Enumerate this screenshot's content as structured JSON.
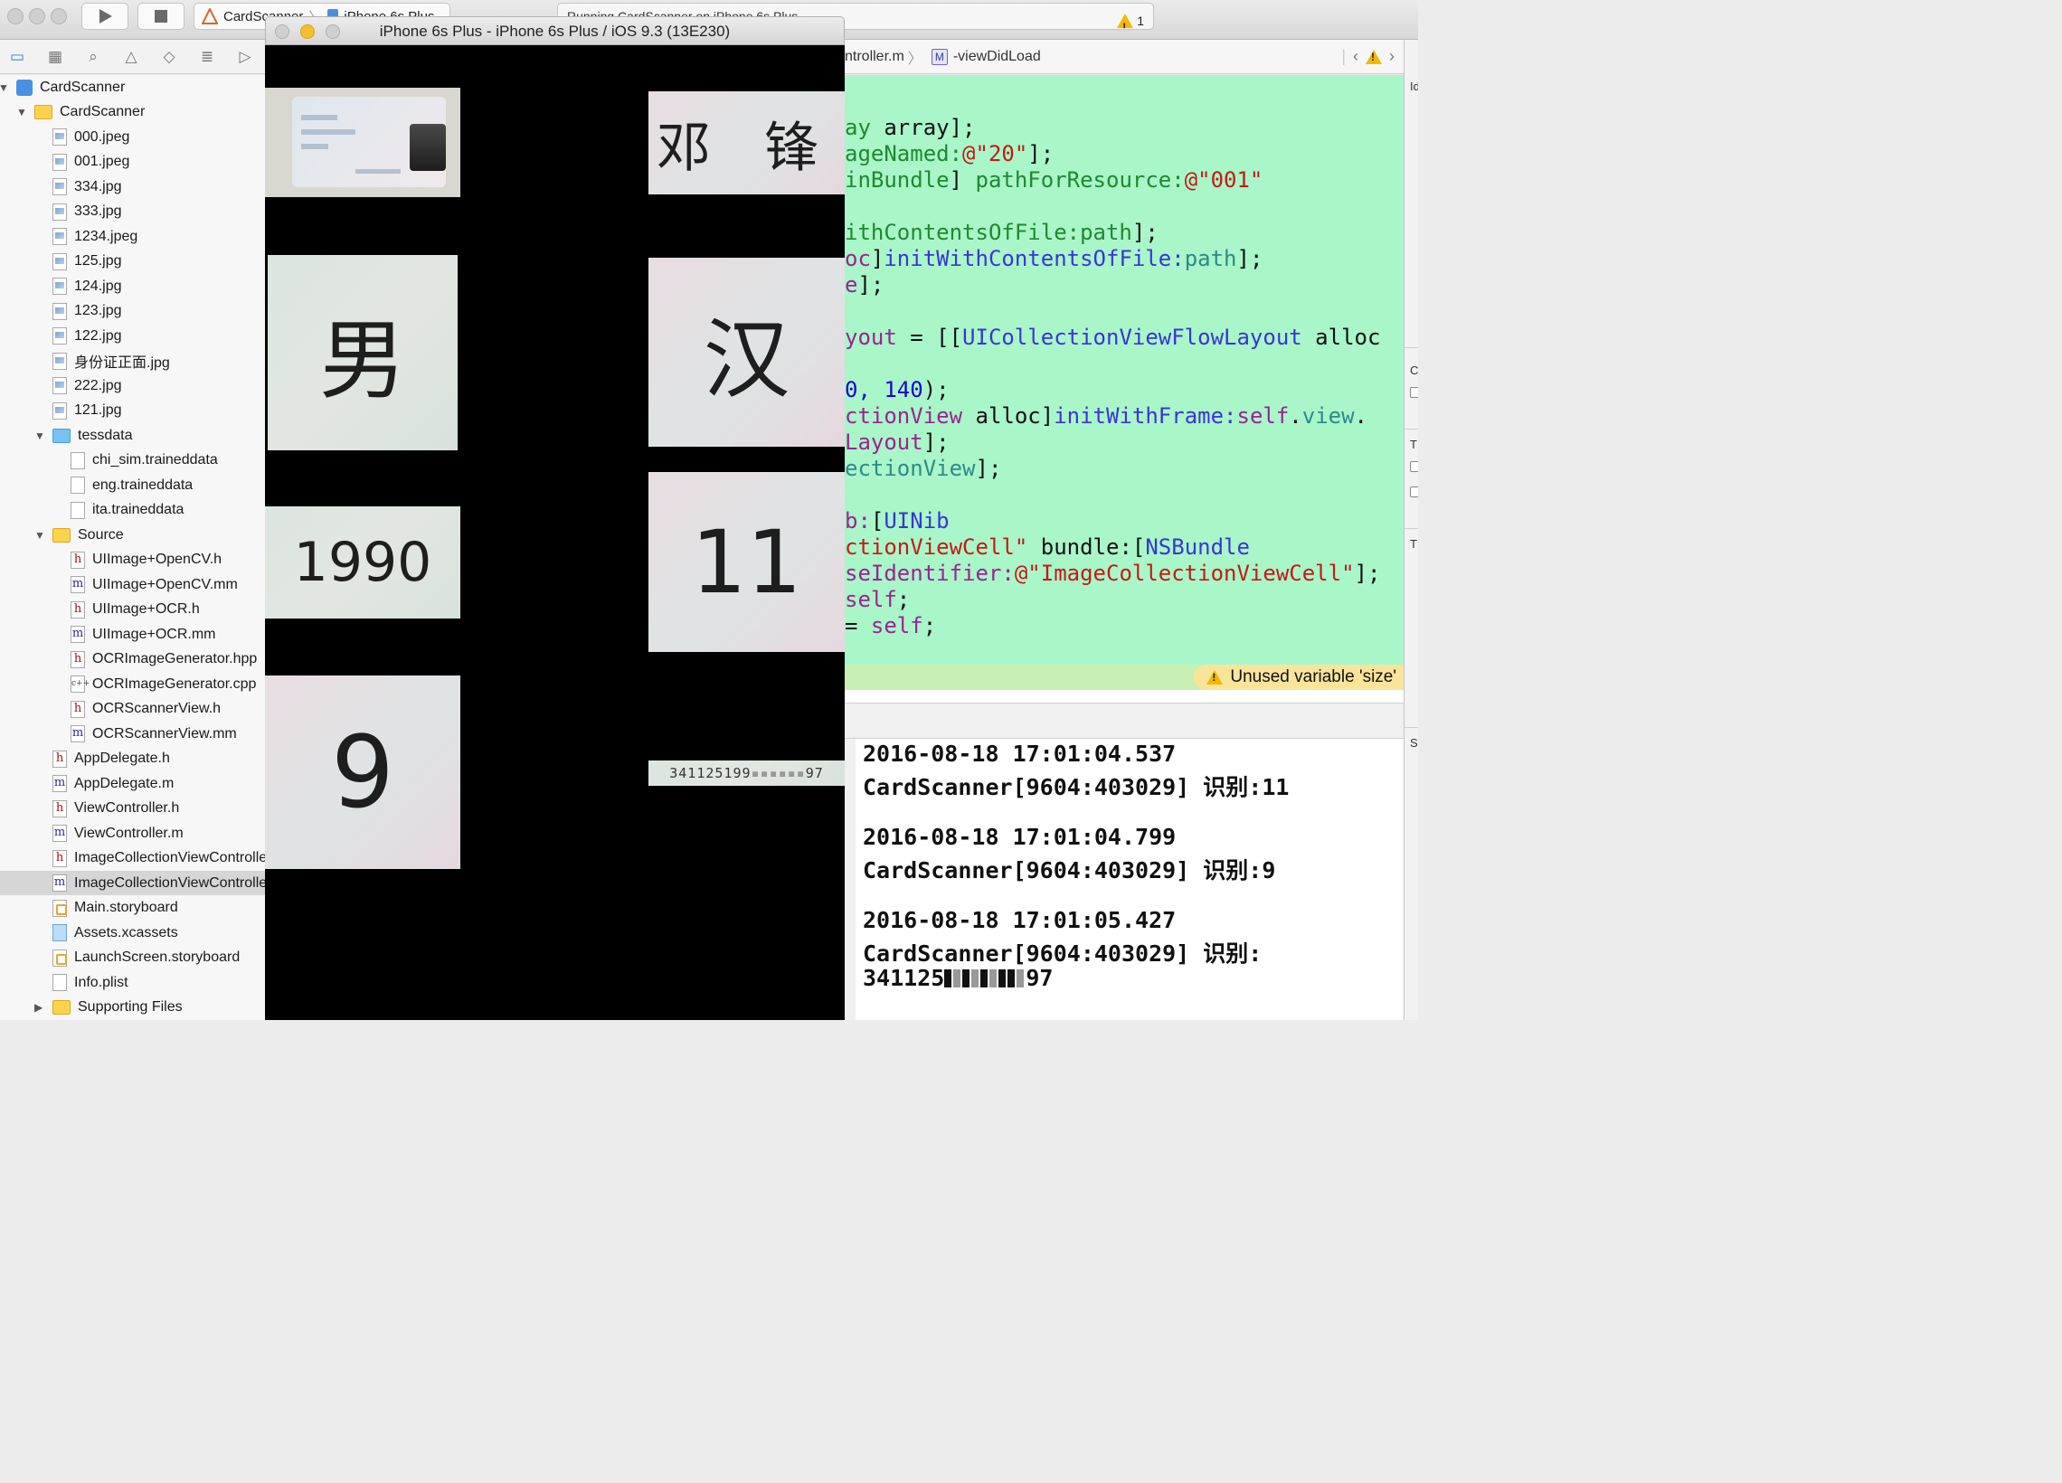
{
  "toolbar": {
    "scheme_app": "CardScanner",
    "scheme_device": "iPhone 6s Plus",
    "activity_text": "Running CardScanner on iPhone 6s Plus",
    "warning_count": "1"
  },
  "navigator": {
    "items": [
      {
        "label": "CardScanner",
        "type": "project",
        "depth": 0,
        "disclosure": "open"
      },
      {
        "label": "CardScanner",
        "type": "folder",
        "depth": 1,
        "disclosure": "open"
      },
      {
        "label": "000.jpeg",
        "type": "image",
        "depth": 2
      },
      {
        "label": "001.jpeg",
        "type": "image",
        "depth": 2
      },
      {
        "label": "334.jpg",
        "type": "image",
        "depth": 2
      },
      {
        "label": "333.jpg",
        "type": "image",
        "depth": 2
      },
      {
        "label": "1234.jpeg",
        "type": "image",
        "depth": 2
      },
      {
        "label": "125.jpg",
        "type": "image",
        "depth": 2
      },
      {
        "label": "124.jpg",
        "type": "image",
        "depth": 2
      },
      {
        "label": "123.jpg",
        "type": "image",
        "depth": 2
      },
      {
        "label": "122.jpg",
        "type": "image",
        "depth": 2
      },
      {
        "label": "身份证正面.jpg",
        "type": "image",
        "depth": 2
      },
      {
        "label": "222.jpg",
        "type": "image",
        "depth": 2
      },
      {
        "label": "121.jpg",
        "type": "image",
        "depth": 2
      },
      {
        "label": "tessdata",
        "type": "bluefolder",
        "depth": 2,
        "disclosure": "open"
      },
      {
        "label": "chi_sim.traineddata",
        "type": "doc",
        "depth": 3
      },
      {
        "label": "eng.traineddata",
        "type": "doc",
        "depth": 3
      },
      {
        "label": "ita.traineddata",
        "type": "doc",
        "depth": 3
      },
      {
        "label": "Source",
        "type": "folder",
        "depth": 2,
        "disclosure": "open"
      },
      {
        "label": "UIImage+OpenCV.h",
        "type": "h",
        "depth": 3
      },
      {
        "label": "UIImage+OpenCV.mm",
        "type": "m",
        "depth": 3
      },
      {
        "label": "UIImage+OCR.h",
        "type": "h",
        "depth": 3
      },
      {
        "label": "UIImage+OCR.mm",
        "type": "m",
        "depth": 3
      },
      {
        "label": "OCRImageGenerator.hpp",
        "type": "h",
        "depth": 3
      },
      {
        "label": "OCRImageGenerator.cpp",
        "type": "cpp",
        "depth": 3
      },
      {
        "label": "OCRScannerView.h",
        "type": "h",
        "depth": 3
      },
      {
        "label": "OCRScannerView.mm",
        "type": "m",
        "depth": 3
      },
      {
        "label": "AppDelegate.h",
        "type": "h",
        "depth": 2
      },
      {
        "label": "AppDelegate.m",
        "type": "m",
        "depth": 2
      },
      {
        "label": "ViewController.h",
        "type": "h",
        "depth": 2
      },
      {
        "label": "ViewController.m",
        "type": "m",
        "depth": 2
      },
      {
        "label": "ImageCollectionViewController.h",
        "type": "h",
        "depth": 2
      },
      {
        "label": "ImageCollectionViewController.m",
        "type": "m",
        "depth": 2,
        "selected": true
      },
      {
        "label": "Main.storyboard",
        "type": "storyboard",
        "depth": 2
      },
      {
        "label": "Assets.xcassets",
        "type": "xcassets",
        "depth": 2
      },
      {
        "label": "LaunchScreen.storyboard",
        "type": "storyboard",
        "depth": 2
      },
      {
        "label": "Info.plist",
        "type": "plist",
        "depth": 2
      },
      {
        "label": "Supporting Files",
        "type": "folder",
        "depth": 2,
        "disclosure": "closed"
      }
    ]
  },
  "simulator": {
    "title": "iPhone 6s Plus - iPhone 6s Plus / iOS 9.3 (13E230)",
    "tiles": [
      {
        "text": "",
        "kind": "idcard"
      },
      {
        "text": "邓 锋"
      },
      {
        "text": "男"
      },
      {
        "text": "汉"
      },
      {
        "text": "1990"
      },
      {
        "text": "11"
      },
      {
        "text": "9"
      },
      {
        "text": "341125199",
        "suffix": "97"
      }
    ]
  },
  "editor": {
    "breadcrumb_file": "ntroller.m",
    "breadcrumb_badge": "M",
    "breadcrumb_method": "-viewDidLoad",
    "warning_message": "Unused variable 'size'"
  },
  "console": {
    "entries": [
      {
        "timestamp": "2016-08-18 17:01:04.537",
        "message": "CardScanner[9604:403029] 识别:11"
      },
      {
        "timestamp": "2016-08-18 17:01:04.799",
        "message": "CardScanner[9604:403029] 识别:9"
      },
      {
        "timestamp": "2016-08-18 17:01:05.427",
        "message": "CardScanner[9604:403029] 识别:",
        "extra_prefix": "341125",
        "extra_suffix": "97"
      }
    ]
  },
  "inspector": {
    "labels": [
      "Id",
      "C",
      "T",
      "T",
      "S"
    ]
  },
  "colors": {
    "editor_highlight": "#a9f6c9",
    "warning_bar": "#c9f0b3",
    "warning_pill": "#fae49a",
    "warning_icon": "#f5b800",
    "selection": "#d6d6d6"
  }
}
